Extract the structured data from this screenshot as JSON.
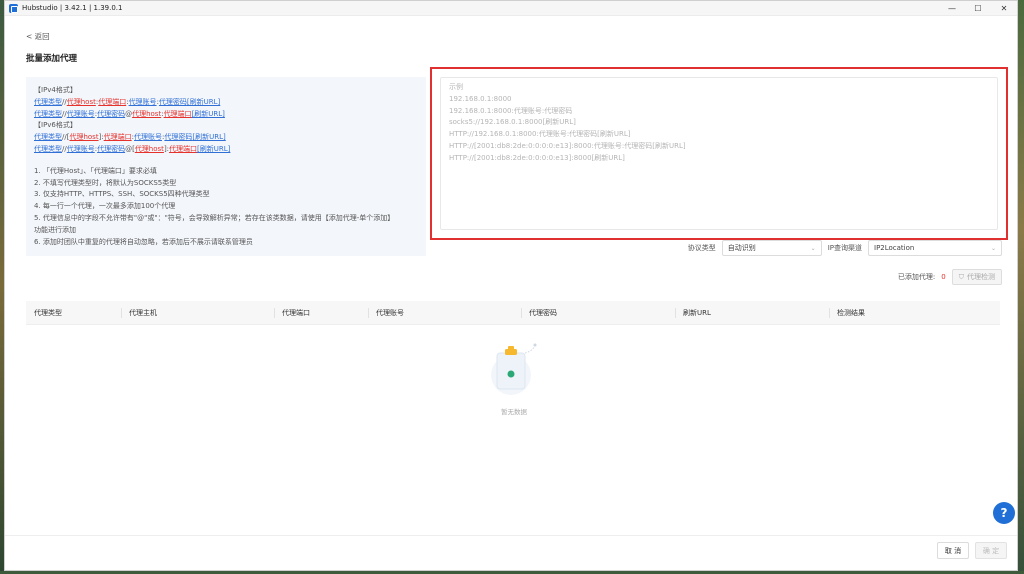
{
  "window": {
    "title": "Hubstudio | 3.42.1 | 1.39.0.1",
    "minimize_glyph": "—",
    "maximize_glyph": "☐",
    "close_glyph": "✕"
  },
  "nav": {
    "back_label": "< 返回"
  },
  "page": {
    "title": "批量添加代理"
  },
  "guide": {
    "ipv4_heading": "【IPv4格式】",
    "ipv4_line1": [
      {
        "t": "代理类型",
        "c": "blue"
      },
      {
        "t": "//",
        "c": "plain"
      },
      {
        "t": "代理host",
        "c": "red"
      },
      {
        "t": ":",
        "c": "plain"
      },
      {
        "t": "代理端口",
        "c": "red"
      },
      {
        "t": ":",
        "c": "plain"
      },
      {
        "t": "代理账号",
        "c": "blue"
      },
      {
        "t": ":",
        "c": "plain"
      },
      {
        "t": "代理密码",
        "c": "blue"
      },
      {
        "t": "[刷新URL]",
        "c": "blue"
      }
    ],
    "ipv4_line2": [
      {
        "t": "代理类型",
        "c": "blue"
      },
      {
        "t": "//",
        "c": "plain"
      },
      {
        "t": "代理账号",
        "c": "blue"
      },
      {
        "t": ":",
        "c": "plain"
      },
      {
        "t": "代理密码",
        "c": "blue"
      },
      {
        "t": "@",
        "c": "plain"
      },
      {
        "t": "代理host",
        "c": "red"
      },
      {
        "t": ":",
        "c": "plain"
      },
      {
        "t": "代理端口",
        "c": "red"
      },
      {
        "t": "[刷新URL]",
        "c": "blue"
      }
    ],
    "ipv6_heading": "【IPv6格式】",
    "ipv6_line1": [
      {
        "t": "代理类型",
        "c": "blue"
      },
      {
        "t": "//[",
        "c": "plain"
      },
      {
        "t": "代理host",
        "c": "red"
      },
      {
        "t": "]:",
        "c": "plain"
      },
      {
        "t": "代理端口",
        "c": "red"
      },
      {
        "t": ":",
        "c": "plain"
      },
      {
        "t": "代理账号",
        "c": "blue"
      },
      {
        "t": ":",
        "c": "plain"
      },
      {
        "t": "代理密码",
        "c": "blue"
      },
      {
        "t": "[刷新URL]",
        "c": "blue"
      }
    ],
    "ipv6_line2": [
      {
        "t": "代理类型",
        "c": "blue"
      },
      {
        "t": "//",
        "c": "plain"
      },
      {
        "t": "代理账号",
        "c": "blue"
      },
      {
        "t": ":",
        "c": "plain"
      },
      {
        "t": "代理密码",
        "c": "blue"
      },
      {
        "t": "@[",
        "c": "plain"
      },
      {
        "t": "代理host",
        "c": "red"
      },
      {
        "t": "]:",
        "c": "plain"
      },
      {
        "t": "代理端口",
        "c": "red"
      },
      {
        "t": "[刷新URL]",
        "c": "blue"
      }
    ],
    "rules": [
      "1. 「代理Host」、「代理端口」要求必填",
      "2. 不填写代理类型时，将默认为SOCKS5类型",
      "3. 仅支持HTTP、HTTPS、SSH、SOCKS5四种代理类型",
      "4. 每一行一个代理，一次最多添加100个代理",
      "5. 代理信息中的字段不允许带有\"@\"或\"：\"符号，会导致解析异常；若存在该类数据，请使用【添加代理-单个添加】",
      "功能进行添加",
      "6. 添加时团队中重复的代理将自动忽略，若添加后不展示请联系管理员"
    ]
  },
  "example": {
    "lines": [
      "示例",
      "192.168.0.1:8000",
      "192.168.0.1:8000:代理账号:代理密码",
      "socks5://192.168.0.1:8000[刷新URL]",
      "HTTP://192.168.0.1:8000:代理账号:代理密码[刷新URL]",
      "HTTP://[2001:db8:2de:0:0:0:0:e13]:8000:代理账号:代理密码[刷新URL]",
      "HTTP://[2001:db8:2de:0:0:0:0:e13]:8000[刷新URL]"
    ]
  },
  "filters": {
    "protocol_label": "协议类型",
    "protocol_value": "自动识别",
    "ip_channel_label": "IP查询渠道",
    "ip_channel_value": "IP2Location"
  },
  "added": {
    "label": "已添加代理:",
    "count": "0",
    "check_button": "代理检测"
  },
  "table": {
    "columns": [
      "代理类型",
      "代理主机",
      "代理端口",
      "代理账号",
      "代理密码",
      "刷新URL",
      "检测结果"
    ],
    "empty_text": "暂无数据"
  },
  "footer": {
    "cancel_label": "取 消",
    "ok_label": "确 定"
  },
  "help": {
    "glyph": "?"
  },
  "colors": {
    "accent": "#1f6fd6",
    "danger": "#e5322d",
    "highlight_border": "#e03030"
  }
}
